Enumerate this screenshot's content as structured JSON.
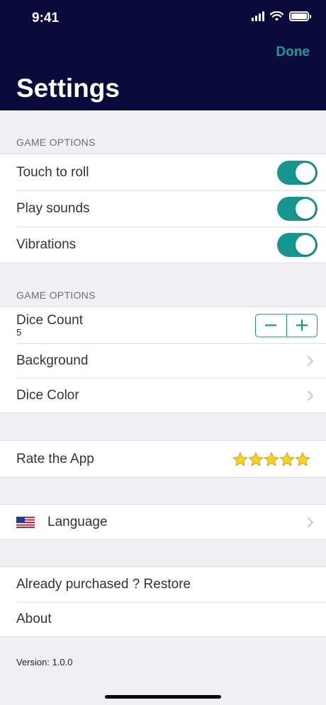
{
  "status_bar": {
    "time": "9:41"
  },
  "header": {
    "done_label": "Done",
    "title": "Settings"
  },
  "sections": {
    "game_options_1": {
      "label": "GAME OPTIONS",
      "rows": [
        {
          "label": "Touch to roll",
          "on": true
        },
        {
          "label": "Play sounds",
          "on": true
        },
        {
          "label": "Vibrations",
          "on": true
        }
      ]
    },
    "game_options_2": {
      "label": "GAME OPTIONS",
      "dice_count": {
        "label": "Dice Count",
        "value": "5"
      },
      "background": {
        "label": "Background"
      },
      "dice_color": {
        "label": "Dice Color"
      }
    },
    "rate": {
      "label": "Rate the App",
      "stars": 5
    },
    "language": {
      "label": "Language"
    },
    "misc": {
      "restore": "Already purchased ? Restore",
      "about": "About"
    }
  },
  "version": "Version: 1.0.0",
  "colors": {
    "header_bg": "#0b0a3c",
    "accent": "#17958f",
    "done": "#1b9e9a",
    "background": "#efeff4"
  }
}
